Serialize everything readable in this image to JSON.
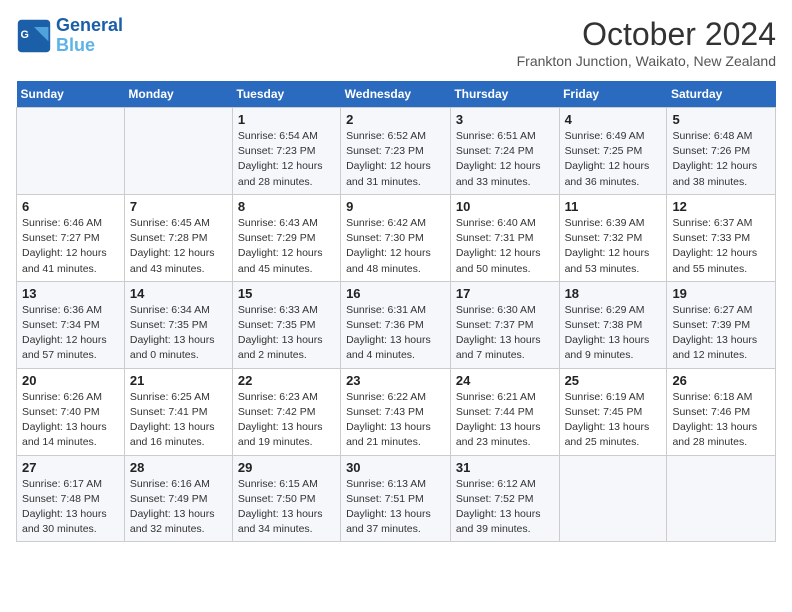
{
  "logo": {
    "line1": "General",
    "line2": "Blue"
  },
  "title": "October 2024",
  "subtitle": "Frankton Junction, Waikato, New Zealand",
  "days_of_week": [
    "Sunday",
    "Monday",
    "Tuesday",
    "Wednesday",
    "Thursday",
    "Friday",
    "Saturday"
  ],
  "weeks": [
    [
      {
        "day": "",
        "info": ""
      },
      {
        "day": "",
        "info": ""
      },
      {
        "day": "1",
        "info": "Sunrise: 6:54 AM\nSunset: 7:23 PM\nDaylight: 12 hours and 28 minutes."
      },
      {
        "day": "2",
        "info": "Sunrise: 6:52 AM\nSunset: 7:23 PM\nDaylight: 12 hours and 31 minutes."
      },
      {
        "day": "3",
        "info": "Sunrise: 6:51 AM\nSunset: 7:24 PM\nDaylight: 12 hours and 33 minutes."
      },
      {
        "day": "4",
        "info": "Sunrise: 6:49 AM\nSunset: 7:25 PM\nDaylight: 12 hours and 36 minutes."
      },
      {
        "day": "5",
        "info": "Sunrise: 6:48 AM\nSunset: 7:26 PM\nDaylight: 12 hours and 38 minutes."
      }
    ],
    [
      {
        "day": "6",
        "info": "Sunrise: 6:46 AM\nSunset: 7:27 PM\nDaylight: 12 hours and 41 minutes."
      },
      {
        "day": "7",
        "info": "Sunrise: 6:45 AM\nSunset: 7:28 PM\nDaylight: 12 hours and 43 minutes."
      },
      {
        "day": "8",
        "info": "Sunrise: 6:43 AM\nSunset: 7:29 PM\nDaylight: 12 hours and 45 minutes."
      },
      {
        "day": "9",
        "info": "Sunrise: 6:42 AM\nSunset: 7:30 PM\nDaylight: 12 hours and 48 minutes."
      },
      {
        "day": "10",
        "info": "Sunrise: 6:40 AM\nSunset: 7:31 PM\nDaylight: 12 hours and 50 minutes."
      },
      {
        "day": "11",
        "info": "Sunrise: 6:39 AM\nSunset: 7:32 PM\nDaylight: 12 hours and 53 minutes."
      },
      {
        "day": "12",
        "info": "Sunrise: 6:37 AM\nSunset: 7:33 PM\nDaylight: 12 hours and 55 minutes."
      }
    ],
    [
      {
        "day": "13",
        "info": "Sunrise: 6:36 AM\nSunset: 7:34 PM\nDaylight: 12 hours and 57 minutes."
      },
      {
        "day": "14",
        "info": "Sunrise: 6:34 AM\nSunset: 7:35 PM\nDaylight: 13 hours and 0 minutes."
      },
      {
        "day": "15",
        "info": "Sunrise: 6:33 AM\nSunset: 7:35 PM\nDaylight: 13 hours and 2 minutes."
      },
      {
        "day": "16",
        "info": "Sunrise: 6:31 AM\nSunset: 7:36 PM\nDaylight: 13 hours and 4 minutes."
      },
      {
        "day": "17",
        "info": "Sunrise: 6:30 AM\nSunset: 7:37 PM\nDaylight: 13 hours and 7 minutes."
      },
      {
        "day": "18",
        "info": "Sunrise: 6:29 AM\nSunset: 7:38 PM\nDaylight: 13 hours and 9 minutes."
      },
      {
        "day": "19",
        "info": "Sunrise: 6:27 AM\nSunset: 7:39 PM\nDaylight: 13 hours and 12 minutes."
      }
    ],
    [
      {
        "day": "20",
        "info": "Sunrise: 6:26 AM\nSunset: 7:40 PM\nDaylight: 13 hours and 14 minutes."
      },
      {
        "day": "21",
        "info": "Sunrise: 6:25 AM\nSunset: 7:41 PM\nDaylight: 13 hours and 16 minutes."
      },
      {
        "day": "22",
        "info": "Sunrise: 6:23 AM\nSunset: 7:42 PM\nDaylight: 13 hours and 19 minutes."
      },
      {
        "day": "23",
        "info": "Sunrise: 6:22 AM\nSunset: 7:43 PM\nDaylight: 13 hours and 21 minutes."
      },
      {
        "day": "24",
        "info": "Sunrise: 6:21 AM\nSunset: 7:44 PM\nDaylight: 13 hours and 23 minutes."
      },
      {
        "day": "25",
        "info": "Sunrise: 6:19 AM\nSunset: 7:45 PM\nDaylight: 13 hours and 25 minutes."
      },
      {
        "day": "26",
        "info": "Sunrise: 6:18 AM\nSunset: 7:46 PM\nDaylight: 13 hours and 28 minutes."
      }
    ],
    [
      {
        "day": "27",
        "info": "Sunrise: 6:17 AM\nSunset: 7:48 PM\nDaylight: 13 hours and 30 minutes."
      },
      {
        "day": "28",
        "info": "Sunrise: 6:16 AM\nSunset: 7:49 PM\nDaylight: 13 hours and 32 minutes."
      },
      {
        "day": "29",
        "info": "Sunrise: 6:15 AM\nSunset: 7:50 PM\nDaylight: 13 hours and 34 minutes."
      },
      {
        "day": "30",
        "info": "Sunrise: 6:13 AM\nSunset: 7:51 PM\nDaylight: 13 hours and 37 minutes."
      },
      {
        "day": "31",
        "info": "Sunrise: 6:12 AM\nSunset: 7:52 PM\nDaylight: 13 hours and 39 minutes."
      },
      {
        "day": "",
        "info": ""
      },
      {
        "day": "",
        "info": ""
      }
    ]
  ]
}
